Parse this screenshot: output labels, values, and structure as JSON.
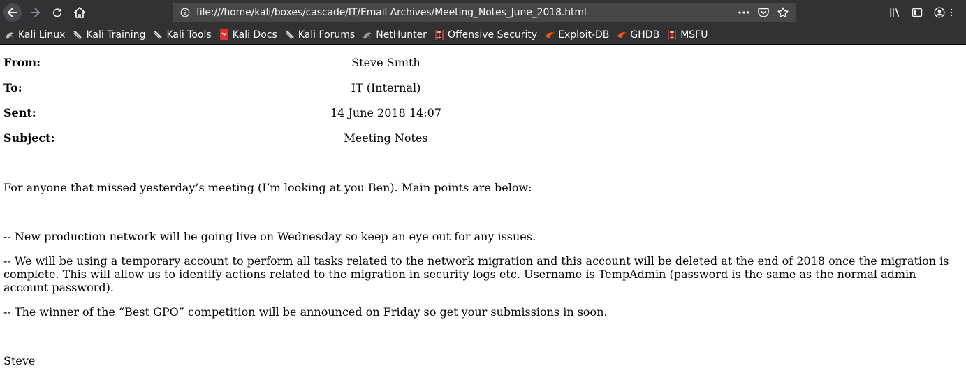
{
  "browser": {
    "url": "file:///home/kali/boxes/cascade/IT/Email Archives/Meeting_Notes_June_2018.html",
    "bookmarks": [
      {
        "label": "Kali Linux",
        "icon": "kali-dragon-icon"
      },
      {
        "label": "Kali Training",
        "icon": "kali-dragon-icon"
      },
      {
        "label": "Kali Tools",
        "icon": "kali-dragon-icon"
      },
      {
        "label": "Kali Docs",
        "icon": "kali-docs-icon"
      },
      {
        "label": "Kali Forums",
        "icon": "kali-dragon-icon"
      },
      {
        "label": "NetHunter",
        "icon": "nethunter-icon"
      },
      {
        "label": "Offensive Security",
        "icon": "offsec-icon"
      },
      {
        "label": "Exploit-DB",
        "icon": "exploit-db-icon"
      },
      {
        "label": "GHDB",
        "icon": "ghdb-icon"
      },
      {
        "label": "MSFU",
        "icon": "offsec-icon"
      }
    ]
  },
  "email": {
    "from_label": "From:",
    "from_value": "Steve Smith",
    "to_label": "To:",
    "to_value": "IT (Internal)",
    "sent_label": "Sent:",
    "sent_value": "14 June 2018 14:07",
    "subject_label": "Subject:",
    "subject_value": "Meeting Notes",
    "intro": "For anyone that missed yesterday’s meeting (I’m looking at you Ben). Main points are below:",
    "point1": "-- New production network will be going live on Wednesday so keep an eye out for any issues.",
    "point2": "-- We will be using a temporary account to perform all tasks related to the network migration and this account will be deleted at the end of 2018 once the migration is complete. This will allow us to identify actions related to the migration in security logs etc. Username is TempAdmin (password is the same as the normal admin account password).",
    "point3": "-- The winner of the “Best GPO” competition will be announced on Friday so get your submissions in soon.",
    "signature": "Steve"
  }
}
